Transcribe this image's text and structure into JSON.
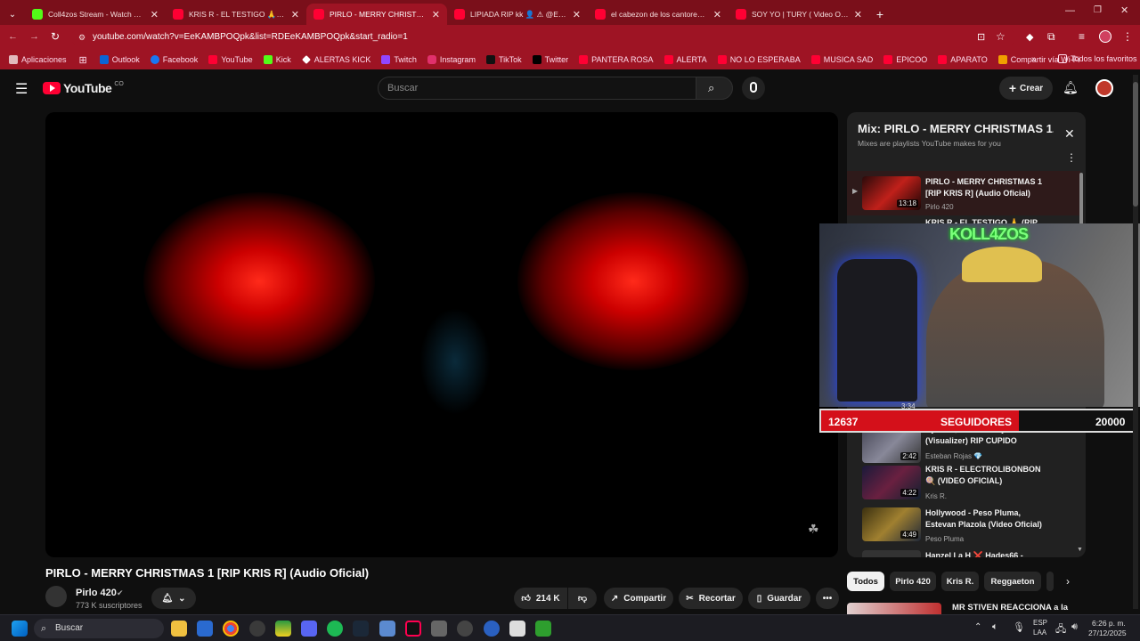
{
  "tabs": [
    {
      "title": "Coll4zos Stream - Watch Live o",
      "color": "#53fc18"
    },
    {
      "title": "KRIS R - EL TESTIGO 🙏 (RIP PI",
      "color": "#ff0033"
    },
    {
      "title": "PIRLO - MERRY CHRISTMAS 1 |",
      "color": "#ff0033"
    },
    {
      "title": "LIPIADA RIP kk 👤 ⚠ @Esteba",
      "color": "#ff0033"
    },
    {
      "title": "el cabezon de los cantores de c",
      "color": "#ff0033"
    },
    {
      "title": "SOY YO | TURY ( Video Oficial )",
      "color": "#ff0033"
    }
  ],
  "url": "youtube.com/watch?v=EeKAMBPOQpk&list=RDEeKAMBPOQpk&start_radio=1",
  "bookmarks": [
    "Aplicaciones",
    "Outlook",
    "Facebook",
    "YouTube",
    "Kick",
    "ALERTAS KICK",
    "Twitch",
    "Instagram",
    "TikTok",
    "Twitter",
    "PANTERA ROSA",
    "ALERTA",
    "NO LO ESPERABA",
    "MUSICA SAD",
    "EPICOO",
    "APARATO",
    "Compartir vía Wi-Fi"
  ],
  "bookmarks_all": "Todos los favoritos",
  "yt": {
    "logo": "YouTube",
    "region": "CO",
    "search_placeholder": "Buscar",
    "create": "Crear"
  },
  "video": {
    "title": "PIRLO - MERRY CHRISTMAS 1 [RIP KRIS R] (Audio Oficial)",
    "channel": "Pirlo 420",
    "subs": "773 K suscriptores",
    "likes": "214 K",
    "share": "Compartir",
    "clip": "Recortar",
    "save": "Guardar"
  },
  "playlist": {
    "title": "Mix: PIRLO - MERRY CHRISTMAS 1...",
    "subtitle": "Mixes are playlists YouTube makes for you",
    "items": [
      {
        "title": "PIRLO - MERRY CHRISTMAS 1 [RIP KRIS R] (Audio Oficial)",
        "channel": "Pirlo 420",
        "duration": "13:18"
      },
      {
        "title": "KRIS R - EL TESTIGO 🙏 (RIP",
        "channel": "",
        "duration": ""
      },
      {
        "title": "Ojala - @EstebanRojas083 (Visualizer) RIP CUPIDO",
        "channel": "Esteban Rojas 💎",
        "duration": "2:42"
      },
      {
        "title": "KRIS R - ELECTROLIBONBON 🍭 (VIDEO OFICIAL)",
        "channel": "Kris R.",
        "duration": "4:22"
      },
      {
        "title": "Hollywood - Peso Pluma, Estevan Plazola (Video Oficial)",
        "channel": "Peso Pluma",
        "duration": "4:49"
      },
      {
        "title": "Hanzel La H ❌ Hades66 -",
        "channel": "",
        "duration": ""
      }
    ],
    "hidden_duration": "3:34"
  },
  "overlay": {
    "brand": "KOLL4ZOS",
    "count": "12637",
    "label": "SEGUIDORES",
    "goal": "20000",
    "progress": 0.632
  },
  "chips": [
    "Todos",
    "Pirlo 420",
    "Kris R.",
    "Reggaeton"
  ],
  "next_rec": "MR STIVEN REACCIONA a la",
  "taskbar": {
    "search": "Buscar",
    "lang": "ESP",
    "lang2": "LAA",
    "time": "6:26 p. m.",
    "date": "27/12/2025"
  }
}
